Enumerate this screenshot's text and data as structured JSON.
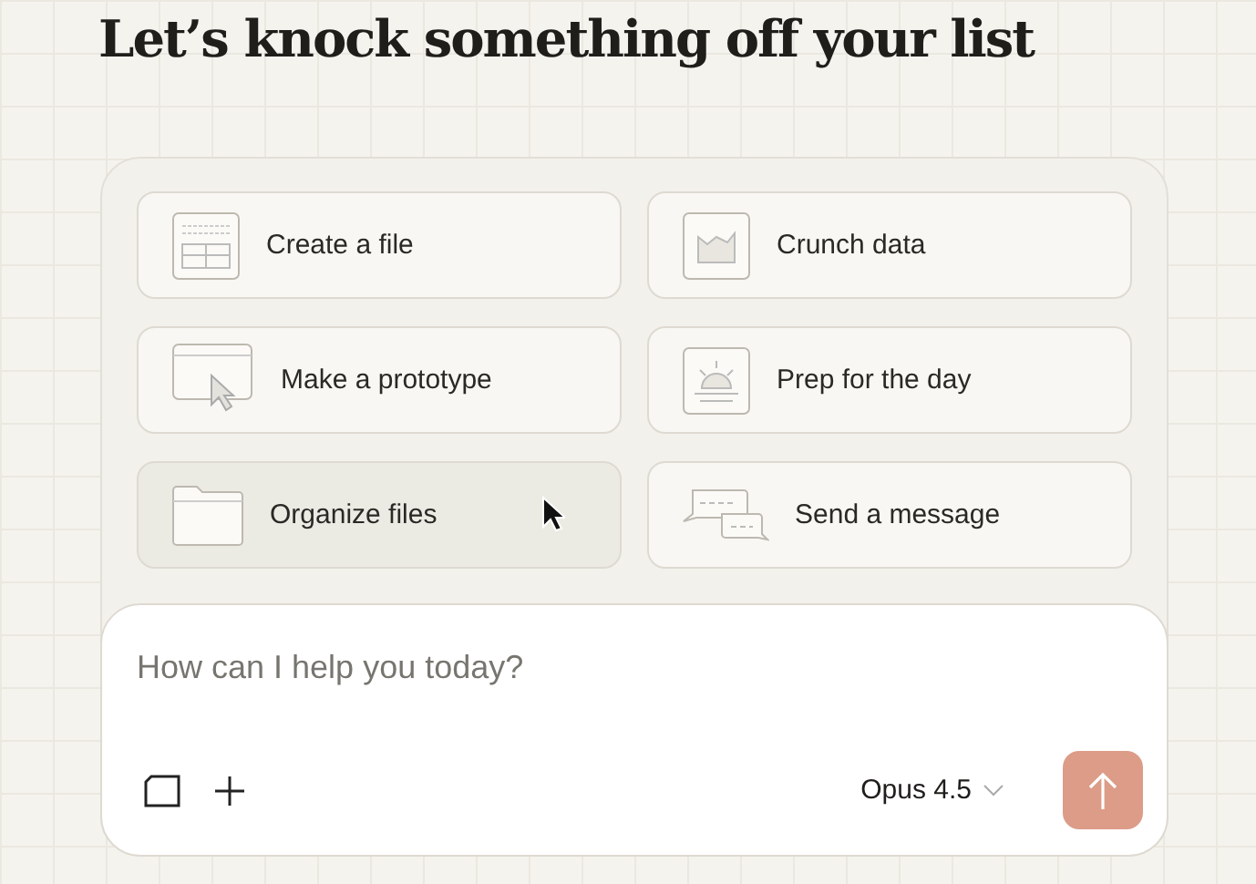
{
  "heading": "Let’s knock something off your list",
  "suggestions": [
    {
      "kind": "table",
      "label": "Create a file",
      "hovered": false
    },
    {
      "kind": "chart",
      "label": "Crunch data",
      "hovered": false
    },
    {
      "kind": "browser",
      "label": "Make a prototype",
      "hovered": false
    },
    {
      "kind": "sunrise",
      "label": "Prep for the day",
      "hovered": false
    },
    {
      "kind": "folder",
      "label": "Organize files",
      "hovered": true
    },
    {
      "kind": "chat",
      "label": "Send a message",
      "hovered": false
    }
  ],
  "composer": {
    "placeholder": "How can I help you today?",
    "model": "Opus 4.5"
  }
}
